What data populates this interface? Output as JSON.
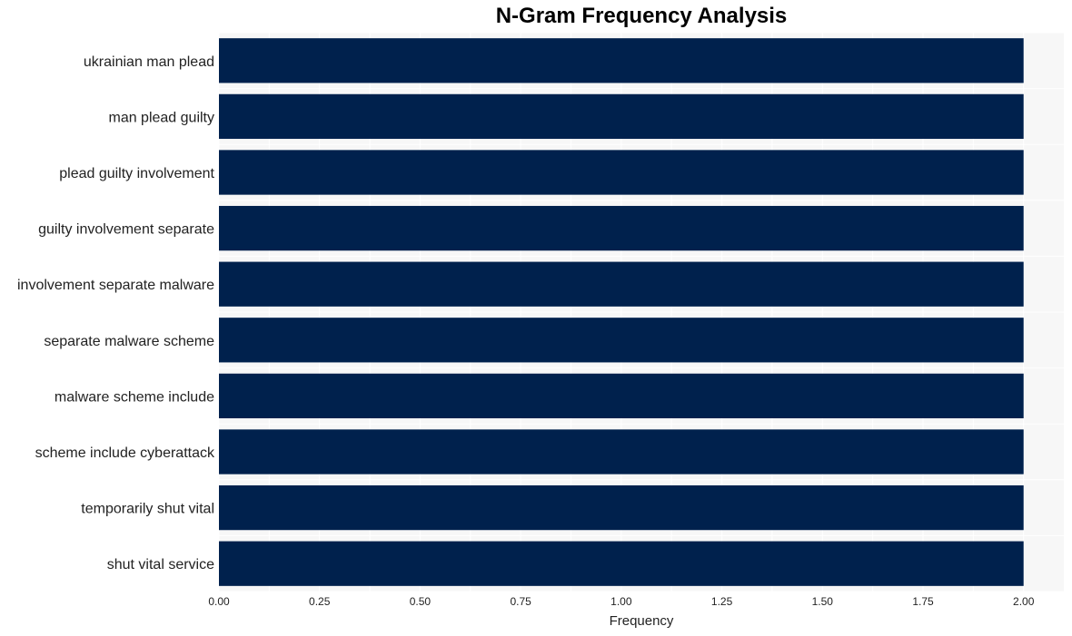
{
  "chart_data": {
    "type": "bar",
    "orientation": "horizontal",
    "title": "N-Gram Frequency Analysis",
    "xlabel": "Frequency",
    "ylabel": "",
    "categories": [
      "ukrainian man plead",
      "man plead guilty",
      "plead guilty involvement",
      "guilty involvement separate",
      "involvement separate malware",
      "separate malware scheme",
      "malware scheme include",
      "scheme include cyberattack",
      "temporarily shut vital",
      "shut vital service"
    ],
    "values": [
      2,
      2,
      2,
      2,
      2,
      2,
      2,
      2,
      2,
      2
    ],
    "xlim": [
      0,
      2.1
    ],
    "xticks": [
      "0.00",
      "0.25",
      "0.50",
      "0.75",
      "1.00",
      "1.25",
      "1.50",
      "1.75",
      "2.00"
    ],
    "grid": true,
    "bar_color": "#00214d",
    "background": "#f7f7f7"
  }
}
